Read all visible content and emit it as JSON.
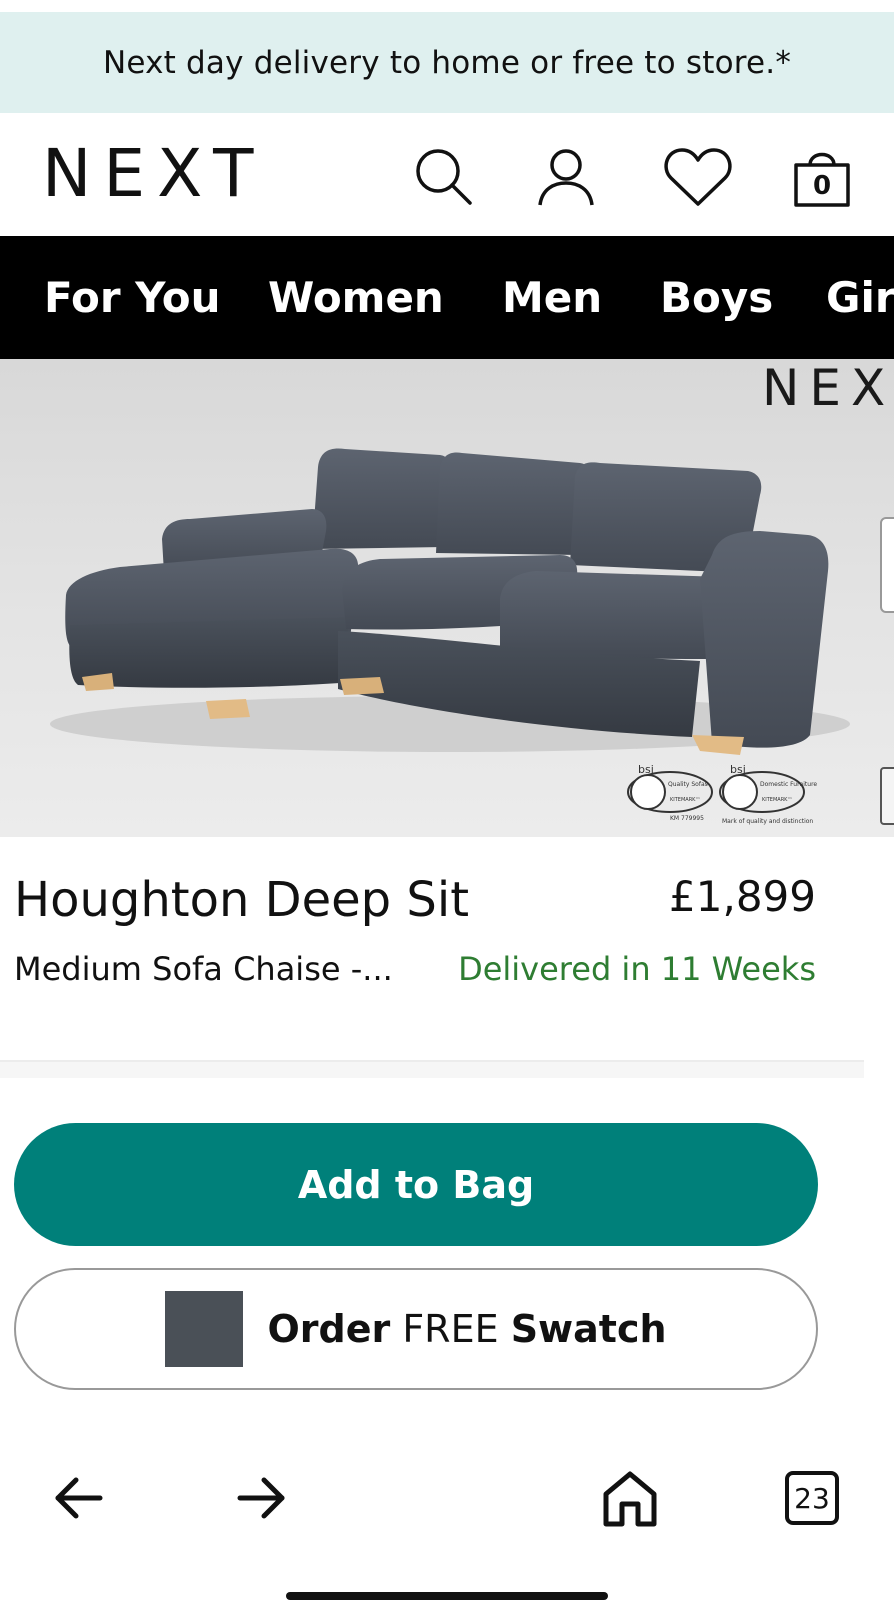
{
  "banner": {
    "text": "Next day delivery to home or free to store.*"
  },
  "header": {
    "logo": "NEXT",
    "icons": [
      "search-icon",
      "account-icon",
      "heart-icon",
      "bag-icon"
    ],
    "bag_count": "0"
  },
  "nav": {
    "items": [
      {
        "label": "For You"
      },
      {
        "label": "Women"
      },
      {
        "label": "Men"
      },
      {
        "label": "Boys"
      },
      {
        "label": "Gir"
      }
    ]
  },
  "hero": {
    "brand_watermark": "NEX",
    "badge_text": "bsi",
    "badge_small_1": "Quality Sofas",
    "badge_small_2": "Domestic Furniture",
    "kitemark_label": "KITEMARK™",
    "cert_number": "KM 779995",
    "badge_caption": "Mark of quality and distinction"
  },
  "product": {
    "title": "Houghton Deep Sit",
    "price": "£1,899",
    "subtitle": "Medium Sofa Chaise -...",
    "delivery": "Delivered in 11 Weeks"
  },
  "actions": {
    "add_to_bag": "Add to Bag",
    "swatch_prefix": "Order",
    "swatch_free": "FREE",
    "swatch_suffix": "Swatch"
  },
  "browser_bar": {
    "icons": [
      "back-arrow-icon",
      "forward-arrow-icon",
      "home-icon",
      "tabs-icon"
    ],
    "tab_count": "23"
  },
  "colors": {
    "banner_bg": "#dff0ef",
    "nav_bg": "#000000",
    "accent_teal": "#00807a",
    "delivery_green": "#2e7d32",
    "swatch_color": "#4a5057"
  }
}
